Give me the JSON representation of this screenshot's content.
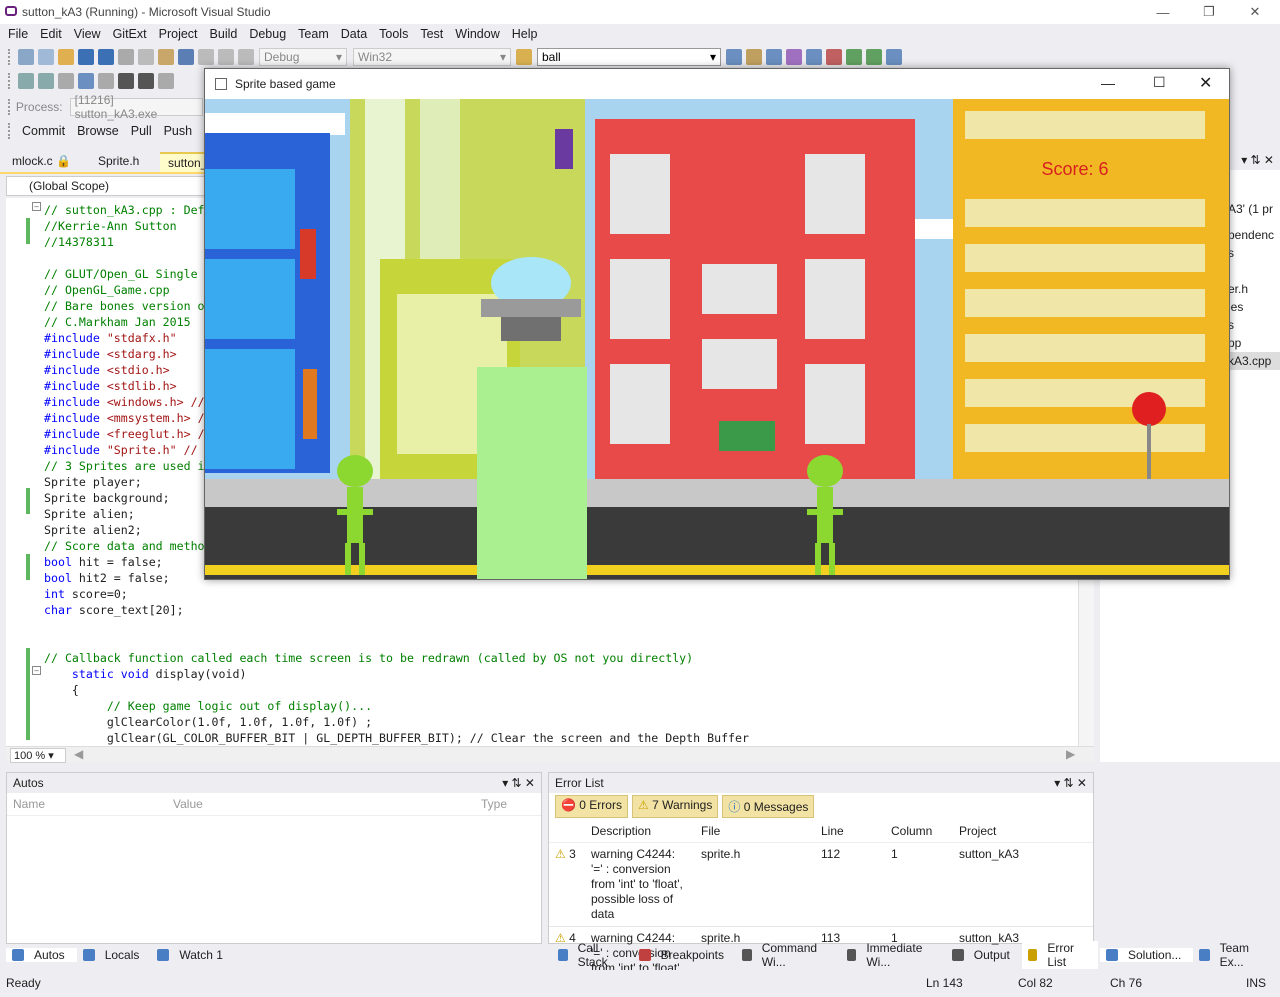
{
  "window": {
    "title": "sutton_kA3 (Running) - Microsoft Visual Studio"
  },
  "menu": [
    "File",
    "Edit",
    "View",
    "GitExt",
    "Project",
    "Build",
    "Debug",
    "Team",
    "Data",
    "Tools",
    "Test",
    "Window",
    "Help"
  ],
  "toolbar": {
    "config": "Debug",
    "platform": "Win32",
    "search_value": "ball"
  },
  "process_bar": {
    "label": "Process:",
    "value": "[11216] sutton_kA3.exe"
  },
  "git_bar": {
    "commit": "Commit",
    "browse": "Browse",
    "pull": "Pull",
    "push": "Push"
  },
  "doc_tabs": [
    {
      "label": "mlock.c"
    },
    {
      "label": "Sprite.h"
    },
    {
      "label": "sutton_"
    }
  ],
  "scope": "(Global Scope)",
  "zoom": "100 %",
  "code_lines": [
    "// sutton_kA3.cpp : Def",
    "//Kerrie-Ann Sutton",
    "//14378311",
    "",
    "// GLUT/Open_GL Single",
    "// OpenGL_Game.cpp",
    "// Bare bones version o",
    "// C.Markham Jan 2015",
    "#include \"stdafx.h\"",
    "#include <stdarg.h>",
    "#include <stdio.h>",
    "#include <stdlib.h>",
    "#include <windows.h> //",
    "#include <mmsystem.h> /",
    "#include <freeglut.h> /",
    "#include \"Sprite.h\" //",
    "// 3 Sprites are used i",
    "Sprite player;",
    "Sprite background;",
    "Sprite alien;",
    "Sprite alien2;",
    "// Score data and metho",
    "bool hit = false;",
    "bool hit2 = false;",
    "int score=0;",
    "char score_text[20];",
    "",
    "",
    "// Callback function called each time screen is to be redrawn (called by OS not you directly)",
    "    static void display(void)",
    "    {",
    "         // Keep game logic out of display()...",
    "         glClearColor(1.0f, 1.0f, 1.0f, 1.0f) ;",
    "         glClear(GL_COLOR_BUFFER_BIT | GL_DEPTH_BUFFER_BIT); // Clear the screen and the Depth Buffer"
  ],
  "right_panel": {
    "items": [
      "A3' (1 pr",
      "pendenc",
      "s",
      "er.h",
      "les",
      "s",
      "pp",
      "kA3.cpp"
    ]
  },
  "autos": {
    "title": "Autos",
    "columns": [
      "Name",
      "Value",
      "Type"
    ]
  },
  "error_list": {
    "title": "Error List",
    "filters": {
      "errors": "0 Errors",
      "warnings": "7 Warnings",
      "messages": "0 Messages"
    },
    "columns": [
      "Description",
      "File",
      "Line",
      "Column",
      "Project"
    ],
    "rows": [
      {
        "num": "3",
        "desc": "warning C4244: '=' : conversion from 'int' to 'float', possible loss of data",
        "file": "sprite.h",
        "line": "112",
        "col": "1",
        "project": "sutton_kA3"
      },
      {
        "num": "4",
        "desc": "warning C4244: '=' : conversion from 'int' to 'float'",
        "file": "sprite.h",
        "line": "113",
        "col": "1",
        "project": "sutton_kA3"
      }
    ]
  },
  "bottom_tabs_left": [
    "Autos",
    "Locals",
    "Watch 1"
  ],
  "bottom_tabs_mid": [
    "Call Stack",
    "Breakpoints",
    "Command Wi...",
    "Immediate Wi...",
    "Output",
    "Error List"
  ],
  "bottom_tabs_right": [
    "Solution...",
    "Team Ex..."
  ],
  "status": {
    "ready": "Ready",
    "ln": "Ln 143",
    "col": "Col 82",
    "ch": "Ch 76",
    "ins": "INS"
  },
  "game": {
    "title": "Sprite based game",
    "score": "Score: 6"
  }
}
